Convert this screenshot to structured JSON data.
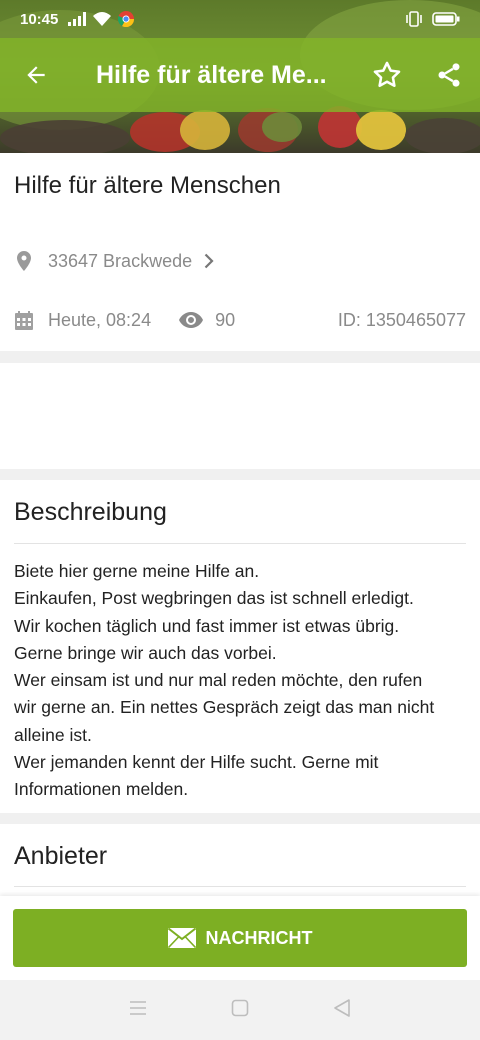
{
  "status_bar": {
    "time": "10:45"
  },
  "toolbar": {
    "title": "Hilfe für ältere Me..."
  },
  "listing": {
    "title": "Hilfe für ältere Menschen",
    "location": "33647 Brackwede",
    "date": "Heute, 08:24",
    "views": "90",
    "id": "ID: 1350465077"
  },
  "description": {
    "heading": "Beschreibung",
    "lines": [
      "Biete hier gerne meine Hilfe an.",
      "Einkaufen, Post wegbringen das ist schnell erledigt.",
      "Wir kochen täglich und fast immer ist etwas übrig.",
      "Gerne bringe wir auch das vorbei.",
      "Wer einsam ist und nur mal reden möchte, den rufen",
      "wir gerne an. Ein nettes Gespräch zeigt das man nicht",
      "alleine ist.",
      "Wer jemanden kennt der Hilfe sucht. Gerne mit",
      "Informationen melden."
    ]
  },
  "provider": {
    "heading": "Anbieter"
  },
  "action": {
    "message_label": "NACHRICHT"
  },
  "colors": {
    "accent": "#7daf23",
    "toolbar": "#82b428"
  }
}
